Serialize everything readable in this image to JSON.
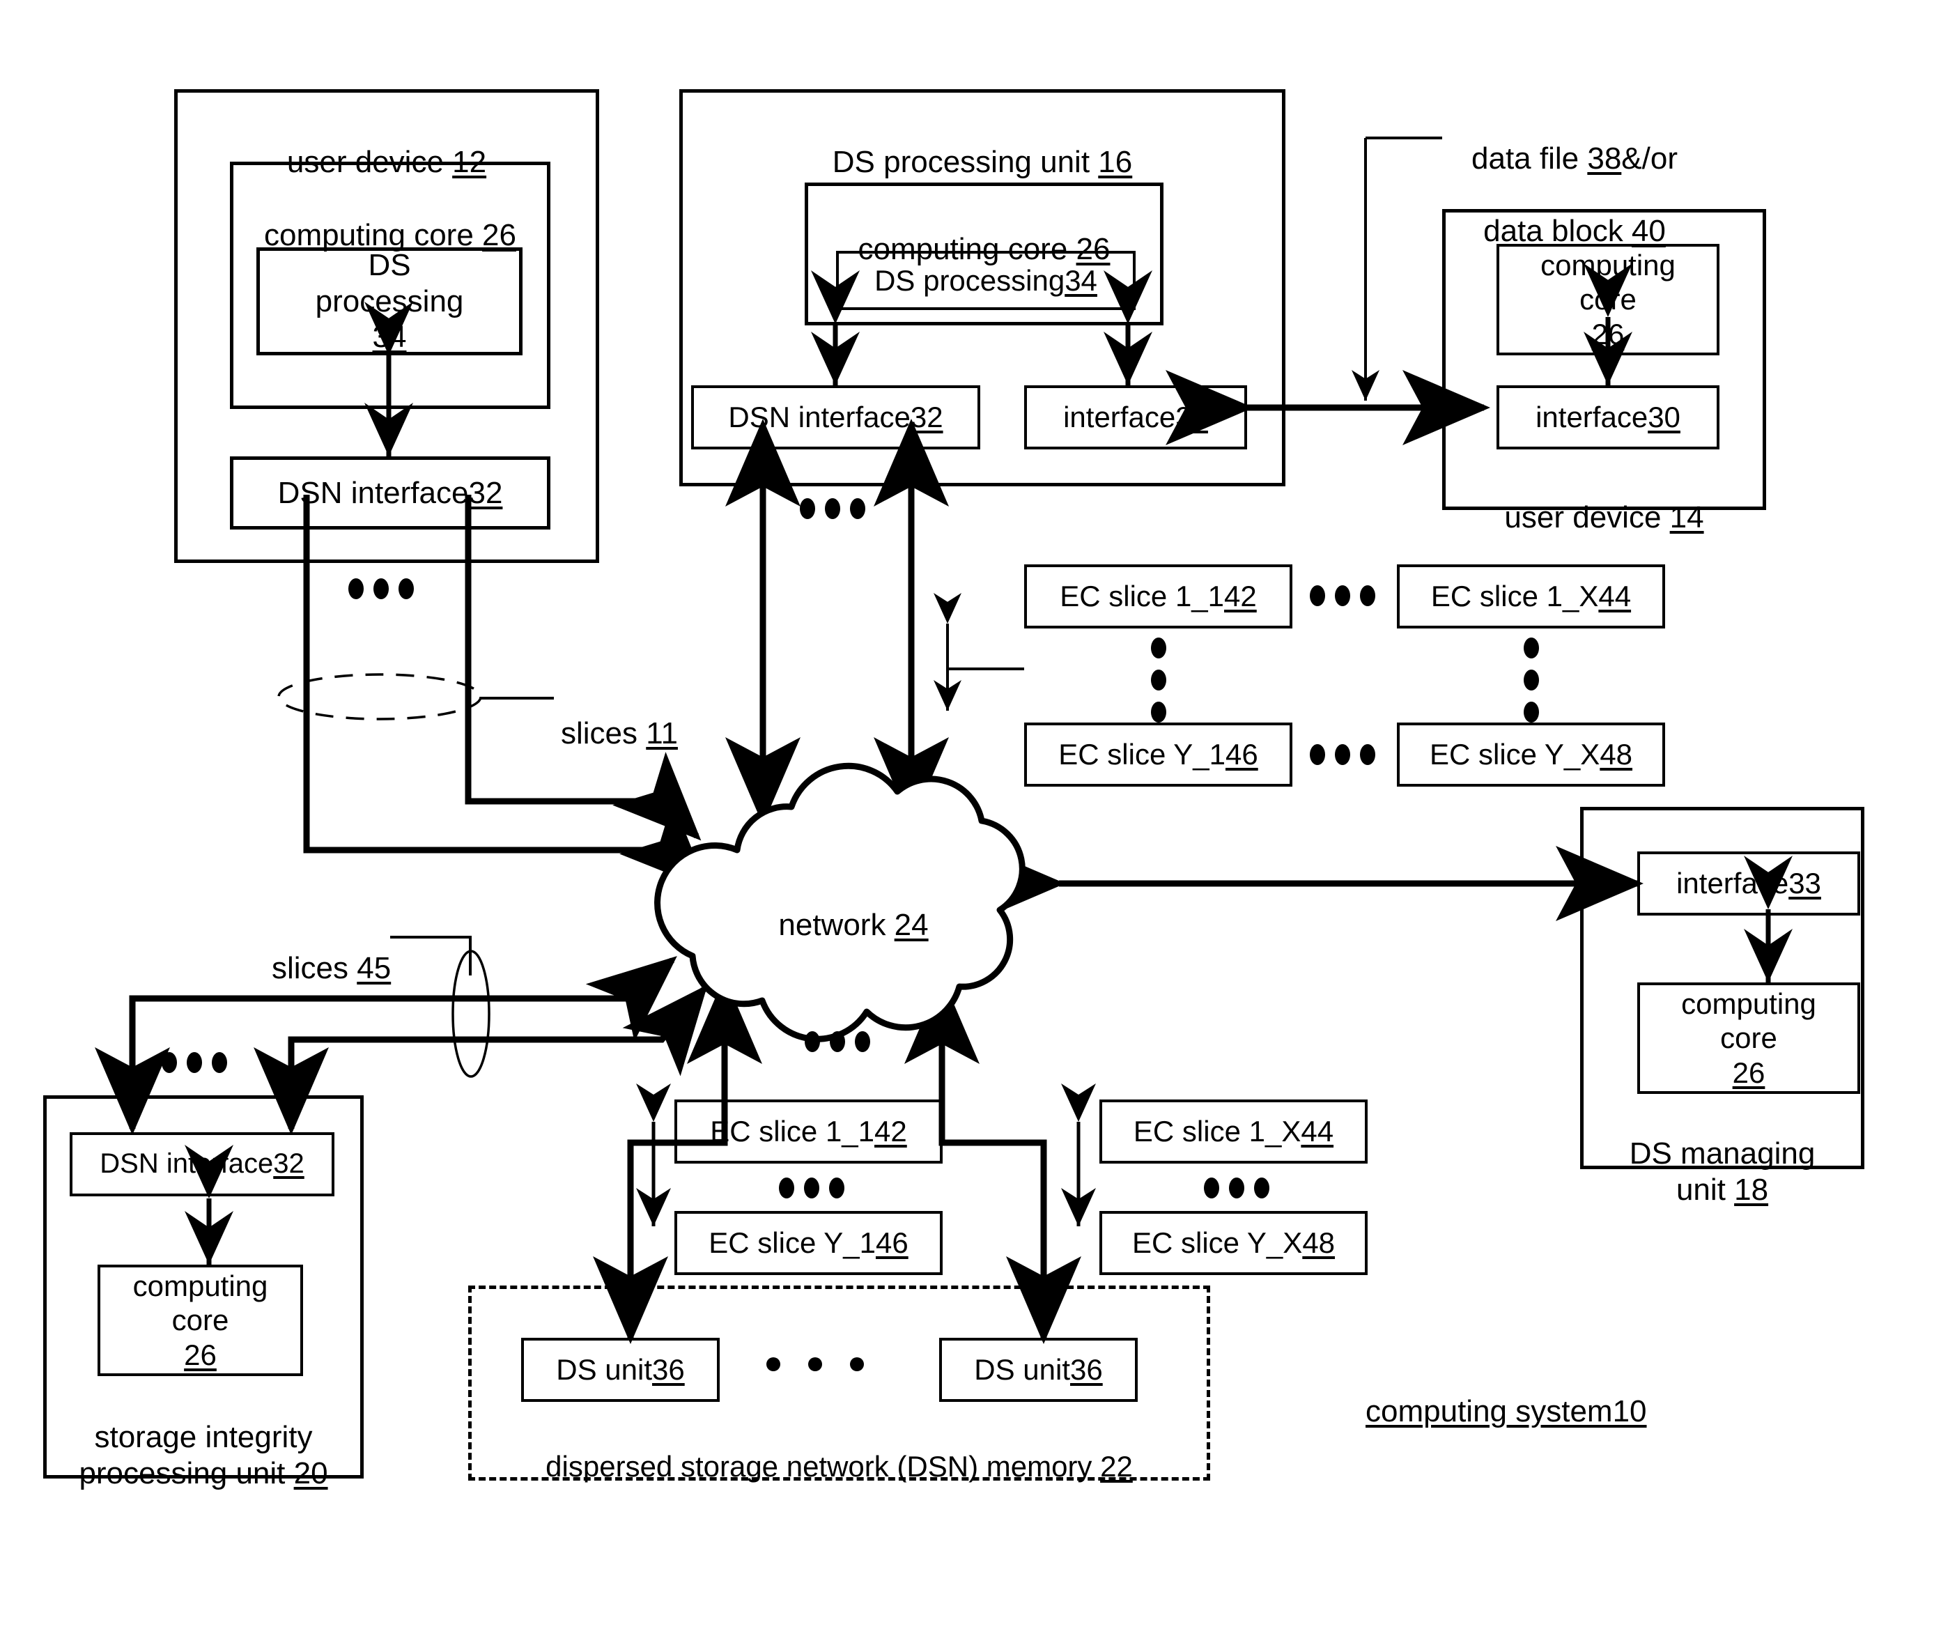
{
  "figure": {
    "title": "computing system10",
    "type": "patent-block-diagram"
  },
  "nodes": {
    "user_device_12": {
      "label": "user device ",
      "ref": "12",
      "computing_core": {
        "label": "computing core ",
        "ref": "26"
      },
      "ds_processing": {
        "label": "DS\nprocessing ",
        "ref": "34"
      },
      "dsn_interface": {
        "label": "DSN interface ",
        "ref": "32"
      }
    },
    "ds_processing_unit_16": {
      "label": "DS processing unit ",
      "ref": "16",
      "computing_core": {
        "label": "computing core ",
        "ref": "26"
      },
      "ds_processing": {
        "label": "DS processing ",
        "ref": "34"
      },
      "dsn_interface": {
        "label": "DSN interface ",
        "ref": "32"
      },
      "interface": {
        "label": "interface ",
        "ref": "30"
      }
    },
    "user_device_14": {
      "label": "user device ",
      "ref": "14",
      "computing_core": {
        "label": "computing\ncore ",
        "ref": "26"
      },
      "interface": {
        "label": "interface ",
        "ref": "30"
      }
    },
    "ds_managing_unit_18": {
      "label": "DS managing\nunit ",
      "ref": "18",
      "interface": {
        "label": "interface ",
        "ref": "33"
      },
      "computing_core": {
        "label": "computing\ncore ",
        "ref": "26"
      }
    },
    "storage_integrity_unit_20": {
      "label": "storage integrity\nprocessing unit ",
      "ref": "20",
      "dsn_interface": {
        "label": "DSN interface ",
        "ref": "32"
      },
      "computing_core": {
        "label": "computing\ncore ",
        "ref": "26"
      }
    },
    "dsn_memory_22": {
      "label": "dispersed storage network (DSN) memory ",
      "ref": "22",
      "ds_unit_left": {
        "label": "DS unit ",
        "ref": "36"
      },
      "ds_unit_right": {
        "label": "DS unit ",
        "ref": "36"
      }
    },
    "network_24": {
      "label": "network ",
      "ref": "24"
    }
  },
  "annotations": {
    "data_file": {
      "line1_a": "data file ",
      "line1_ref": "38",
      "line1_b": "&/or",
      "line2_a": "data block ",
      "line2_ref": "40"
    },
    "slices_11": {
      "label": "slices ",
      "ref": "11"
    },
    "slices_45": {
      "label": "slices ",
      "ref": "45"
    }
  },
  "ec_slices_top": [
    {
      "label": "EC slice 1_1 ",
      "ref": "42"
    },
    {
      "label": "EC slice 1_X ",
      "ref": "44"
    },
    {
      "label": "EC slice Y_1 ",
      "ref": "46"
    },
    {
      "label": "EC slice Y_X ",
      "ref": "48"
    }
  ],
  "ec_slices_bottom": [
    {
      "label": "EC slice 1_1 ",
      "ref": "42"
    },
    {
      "label": "EC slice 1_X ",
      "ref": "44"
    },
    {
      "label": "EC slice Y_1 ",
      "ref": "46"
    },
    {
      "label": "EC slice Y_X ",
      "ref": "48"
    }
  ],
  "colors": {
    "ink": "#000000",
    "paper": "#ffffff"
  }
}
